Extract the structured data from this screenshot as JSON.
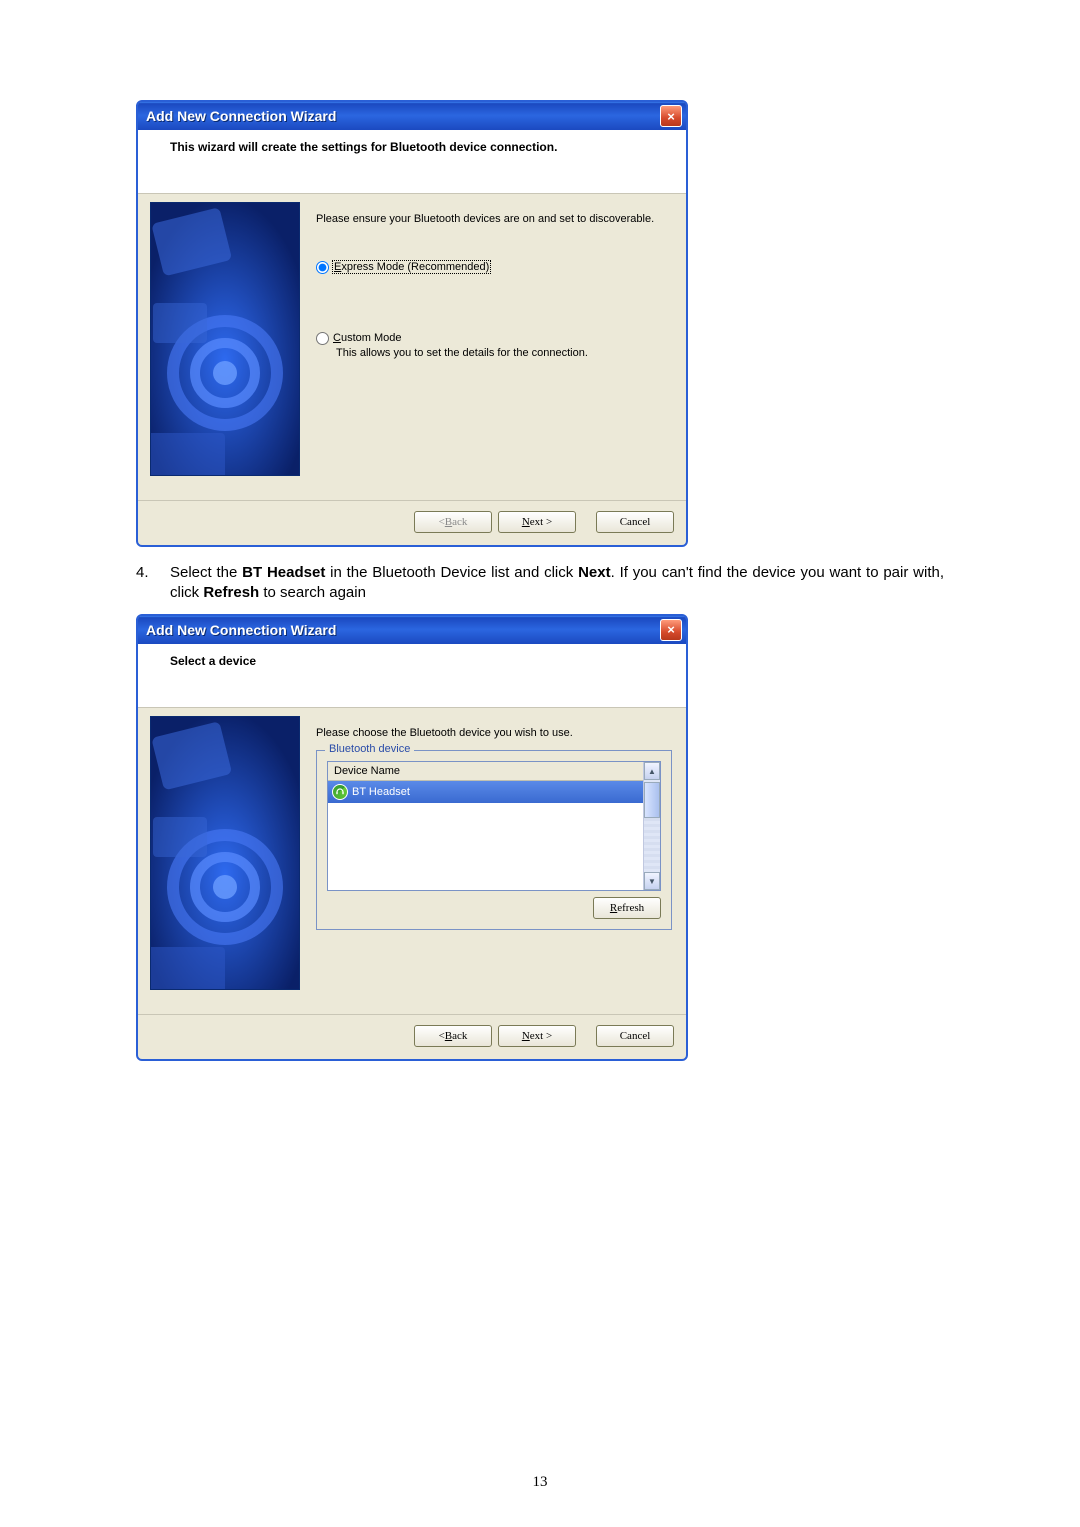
{
  "dialog1": {
    "title": "Add New Connection Wizard",
    "header": "This wizard will create the settings for Bluetooth device connection.",
    "instruction": "Please ensure your Bluetooth devices are on and set to discoverable.",
    "radio_express_pre": "E",
    "radio_express_rest": "xpress Mode (Recommended)",
    "radio_custom_pre": "C",
    "radio_custom_rest": "ustom Mode",
    "custom_desc": "This allows you to set the details for the connection.",
    "back_pre": "< ",
    "back_u": "B",
    "back_rest": "ack",
    "next_u": "N",
    "next_rest": "ext >",
    "cancel": "Cancel"
  },
  "step4": {
    "number": "4.",
    "text_p1": "Select the ",
    "bold1": "BT Headset",
    "text_p2": " in the Bluetooth Device list and click ",
    "bold2": "Next",
    "text_p3": ". If you can't find the device you want to pair with, click ",
    "bold3": "Refresh",
    "text_p4": " to search again"
  },
  "dialog2": {
    "title": "Add New Connection Wizard",
    "header": "Select a device",
    "instruction": "Please choose the Bluetooth device you wish to use.",
    "group_legend": "Bluetooth device",
    "col_header": "Device Name",
    "selected_device": "BT Headset",
    "refresh_u": "R",
    "refresh_rest": "efresh",
    "back_pre": "< ",
    "back_u": "B",
    "back_rest": "ack",
    "next_u": "N",
    "next_rest": "ext >",
    "cancel": "Cancel"
  },
  "page_number": "13"
}
